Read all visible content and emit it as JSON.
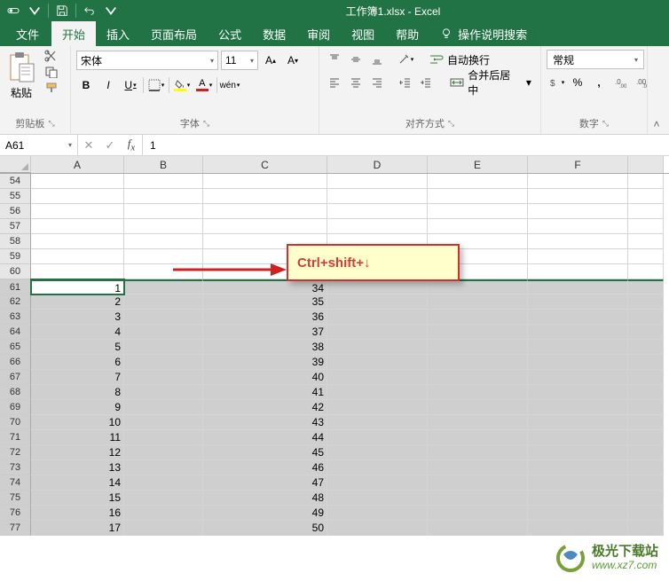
{
  "title": "工作簿1.xlsx - Excel",
  "menus": {
    "file": "文件",
    "home": "开始",
    "insert": "插入",
    "layout": "页面布局",
    "formulas": "公式",
    "data": "数据",
    "review": "审阅",
    "view": "视图",
    "help": "帮助",
    "tell": "操作说明搜索"
  },
  "ribbon": {
    "clipboard": {
      "label": "剪贴板",
      "paste": "粘贴"
    },
    "font": {
      "label": "字体",
      "name": "宋体",
      "size": "11"
    },
    "alignment": {
      "label": "对齐方式",
      "wrap": "自动换行",
      "merge": "合并后居中"
    },
    "number": {
      "label": "数字",
      "format": "常规"
    }
  },
  "namebox": "A61",
  "formula": "1",
  "columns": [
    "A",
    "B",
    "C",
    "D",
    "E",
    "F"
  ],
  "empty_rows": [
    54,
    55,
    56,
    57,
    58,
    59,
    60
  ],
  "data_rows": [
    {
      "n": 61,
      "a": "1",
      "c": "34"
    },
    {
      "n": 62,
      "a": "2",
      "c": "35"
    },
    {
      "n": 63,
      "a": "3",
      "c": "36"
    },
    {
      "n": 64,
      "a": "4",
      "c": "37"
    },
    {
      "n": 65,
      "a": "5",
      "c": "38"
    },
    {
      "n": 66,
      "a": "6",
      "c": "39"
    },
    {
      "n": 67,
      "a": "7",
      "c": "40"
    },
    {
      "n": 68,
      "a": "8",
      "c": "41"
    },
    {
      "n": 69,
      "a": "9",
      "c": "42"
    },
    {
      "n": 70,
      "a": "10",
      "c": "43"
    },
    {
      "n": 71,
      "a": "11",
      "c": "44"
    },
    {
      "n": 72,
      "a": "12",
      "c": "45"
    },
    {
      "n": 73,
      "a": "13",
      "c": "46"
    },
    {
      "n": 74,
      "a": "14",
      "c": "47"
    },
    {
      "n": 75,
      "a": "15",
      "c": "48"
    },
    {
      "n": 76,
      "a": "16",
      "c": "49"
    },
    {
      "n": 77,
      "a": "17",
      "c": "50"
    }
  ],
  "annotation": "Ctrl+shift+↓",
  "watermark": {
    "title": "极光下载站",
    "url": "www.xz7.com"
  }
}
